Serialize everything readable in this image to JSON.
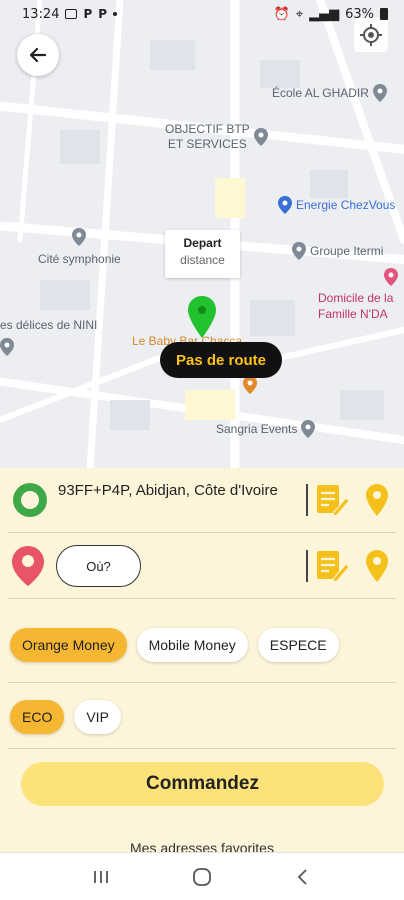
{
  "status_bar": {
    "time": "13:24",
    "notif1": "P",
    "notif2": "P",
    "battery": "63%"
  },
  "map": {
    "pois": [
      {
        "label": "École AL GHADIR"
      },
      {
        "label": "OBJECTIF BTP\nET SERVICES"
      },
      {
        "label": "Energie ChezVous"
      },
      {
        "label": "Groupe Itermi"
      },
      {
        "label": "Cité symphonie"
      },
      {
        "label": "Domicile de la\nFamille N'DA"
      },
      {
        "label": "es délices de NINI"
      },
      {
        "label": "Le Baby Bar Chacca"
      },
      {
        "label": "Sangria Events"
      }
    ],
    "marker_title": "Depart",
    "marker_subtitle": "distance",
    "route_status": "Pas de route"
  },
  "trip": {
    "from_address": "93FF+P4P, Abidjan, Côte d'Ivoire",
    "to_button": "Où?"
  },
  "payment_options": [
    {
      "label": "Orange Money",
      "active": true
    },
    {
      "label": "Mobile Money",
      "active": false
    },
    {
      "label": "ESPECE",
      "active": false
    }
  ],
  "categories": [
    {
      "label": "ECO",
      "active": true
    },
    {
      "label": "VIP",
      "active": false
    }
  ],
  "order_button": "Commandez",
  "favorites_label": "Mes adresses favorites",
  "colors": {
    "accent": "#f5b731",
    "panel_bg": "#fdf5d9",
    "order_button": "#fde27a",
    "from_icon": "#3fa949",
    "to_icon": "#e8556b",
    "route_pill_text": "#fcc21b"
  }
}
